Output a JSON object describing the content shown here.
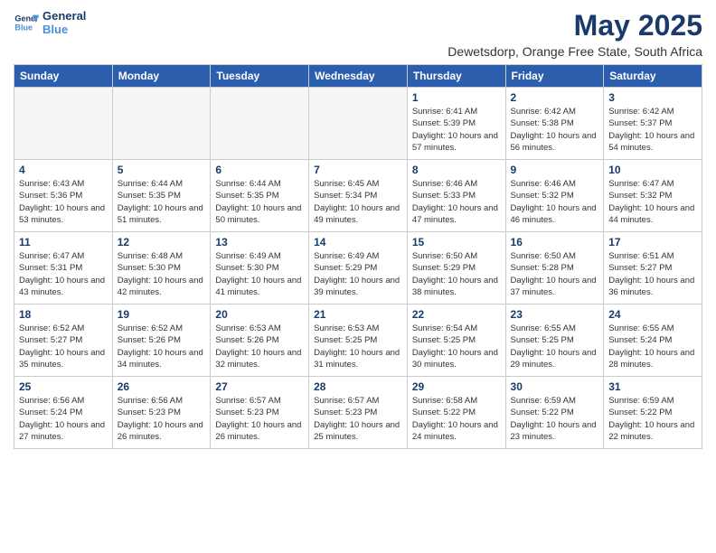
{
  "logo": {
    "line1": "General",
    "line2": "Blue"
  },
  "title": "May 2025",
  "subtitle": "Dewetsdorp, Orange Free State, South Africa",
  "days_of_week": [
    "Sunday",
    "Monday",
    "Tuesday",
    "Wednesday",
    "Thursday",
    "Friday",
    "Saturday"
  ],
  "weeks": [
    [
      {
        "day": "",
        "empty": true
      },
      {
        "day": "",
        "empty": true
      },
      {
        "day": "",
        "empty": true
      },
      {
        "day": "",
        "empty": true
      },
      {
        "day": "1",
        "sunrise": "6:41 AM",
        "sunset": "5:39 PM",
        "daylight": "10 hours and 57 minutes."
      },
      {
        "day": "2",
        "sunrise": "6:42 AM",
        "sunset": "5:38 PM",
        "daylight": "10 hours and 56 minutes."
      },
      {
        "day": "3",
        "sunrise": "6:42 AM",
        "sunset": "5:37 PM",
        "daylight": "10 hours and 54 minutes."
      }
    ],
    [
      {
        "day": "4",
        "sunrise": "6:43 AM",
        "sunset": "5:36 PM",
        "daylight": "10 hours and 53 minutes."
      },
      {
        "day": "5",
        "sunrise": "6:44 AM",
        "sunset": "5:35 PM",
        "daylight": "10 hours and 51 minutes."
      },
      {
        "day": "6",
        "sunrise": "6:44 AM",
        "sunset": "5:35 PM",
        "daylight": "10 hours and 50 minutes."
      },
      {
        "day": "7",
        "sunrise": "6:45 AM",
        "sunset": "5:34 PM",
        "daylight": "10 hours and 49 minutes."
      },
      {
        "day": "8",
        "sunrise": "6:46 AM",
        "sunset": "5:33 PM",
        "daylight": "10 hours and 47 minutes."
      },
      {
        "day": "9",
        "sunrise": "6:46 AM",
        "sunset": "5:32 PM",
        "daylight": "10 hours and 46 minutes."
      },
      {
        "day": "10",
        "sunrise": "6:47 AM",
        "sunset": "5:32 PM",
        "daylight": "10 hours and 44 minutes."
      }
    ],
    [
      {
        "day": "11",
        "sunrise": "6:47 AM",
        "sunset": "5:31 PM",
        "daylight": "10 hours and 43 minutes."
      },
      {
        "day": "12",
        "sunrise": "6:48 AM",
        "sunset": "5:30 PM",
        "daylight": "10 hours and 42 minutes."
      },
      {
        "day": "13",
        "sunrise": "6:49 AM",
        "sunset": "5:30 PM",
        "daylight": "10 hours and 41 minutes."
      },
      {
        "day": "14",
        "sunrise": "6:49 AM",
        "sunset": "5:29 PM",
        "daylight": "10 hours and 39 minutes."
      },
      {
        "day": "15",
        "sunrise": "6:50 AM",
        "sunset": "5:29 PM",
        "daylight": "10 hours and 38 minutes."
      },
      {
        "day": "16",
        "sunrise": "6:50 AM",
        "sunset": "5:28 PM",
        "daylight": "10 hours and 37 minutes."
      },
      {
        "day": "17",
        "sunrise": "6:51 AM",
        "sunset": "5:27 PM",
        "daylight": "10 hours and 36 minutes."
      }
    ],
    [
      {
        "day": "18",
        "sunrise": "6:52 AM",
        "sunset": "5:27 PM",
        "daylight": "10 hours and 35 minutes."
      },
      {
        "day": "19",
        "sunrise": "6:52 AM",
        "sunset": "5:26 PM",
        "daylight": "10 hours and 34 minutes."
      },
      {
        "day": "20",
        "sunrise": "6:53 AM",
        "sunset": "5:26 PM",
        "daylight": "10 hours and 32 minutes."
      },
      {
        "day": "21",
        "sunrise": "6:53 AM",
        "sunset": "5:25 PM",
        "daylight": "10 hours and 31 minutes."
      },
      {
        "day": "22",
        "sunrise": "6:54 AM",
        "sunset": "5:25 PM",
        "daylight": "10 hours and 30 minutes."
      },
      {
        "day": "23",
        "sunrise": "6:55 AM",
        "sunset": "5:25 PM",
        "daylight": "10 hours and 29 minutes."
      },
      {
        "day": "24",
        "sunrise": "6:55 AM",
        "sunset": "5:24 PM",
        "daylight": "10 hours and 28 minutes."
      }
    ],
    [
      {
        "day": "25",
        "sunrise": "6:56 AM",
        "sunset": "5:24 PM",
        "daylight": "10 hours and 27 minutes."
      },
      {
        "day": "26",
        "sunrise": "6:56 AM",
        "sunset": "5:23 PM",
        "daylight": "10 hours and 26 minutes."
      },
      {
        "day": "27",
        "sunrise": "6:57 AM",
        "sunset": "5:23 PM",
        "daylight": "10 hours and 26 minutes."
      },
      {
        "day": "28",
        "sunrise": "6:57 AM",
        "sunset": "5:23 PM",
        "daylight": "10 hours and 25 minutes."
      },
      {
        "day": "29",
        "sunrise": "6:58 AM",
        "sunset": "5:22 PM",
        "daylight": "10 hours and 24 minutes."
      },
      {
        "day": "30",
        "sunrise": "6:59 AM",
        "sunset": "5:22 PM",
        "daylight": "10 hours and 23 minutes."
      },
      {
        "day": "31",
        "sunrise": "6:59 AM",
        "sunset": "5:22 PM",
        "daylight": "10 hours and 22 minutes."
      }
    ]
  ]
}
